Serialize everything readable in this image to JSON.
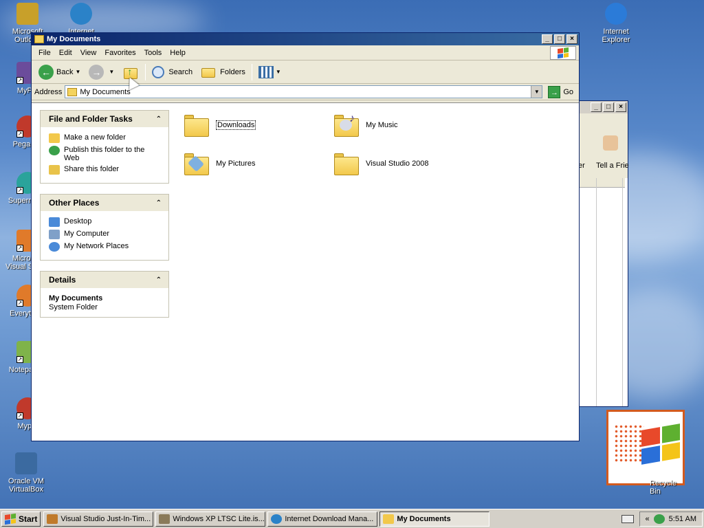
{
  "desktop": {
    "icons": [
      {
        "label": "Microsoft Outlook",
        "color": "#c8a02a"
      },
      {
        "label": "Internet Download Manager",
        "color": "#2b82c8"
      },
      {
        "label": "MyPal",
        "color": "#6b4c9b"
      },
      {
        "label": "Pegasus",
        "color": "#c0392b"
      },
      {
        "label": "Supermium",
        "color": "#2aa39b"
      },
      {
        "label": "Microsoft Visual Studio",
        "color": "#e07a2a"
      },
      {
        "label": "Everything",
        "color": "#e07a2a"
      },
      {
        "label": "Notepad++",
        "color": "#7fb34a"
      },
      {
        "label": "Mypal",
        "color": "#c0392b"
      },
      {
        "label": "Oracle VM VirtualBox",
        "color": "#3b6aa0"
      },
      {
        "label": "Internet Explorer",
        "color": "#2b7bd8"
      }
    ],
    "recycle_bin": "Recycle Bin"
  },
  "explorer": {
    "title": "My Documents",
    "title_buttons": [
      "_",
      "□",
      "×"
    ],
    "menu": [
      "File",
      "Edit",
      "View",
      "Favorites",
      "Tools",
      "Help"
    ],
    "toolbar": {
      "back": "Back",
      "search": "Search",
      "folders": "Folders"
    },
    "address": {
      "label": "Address",
      "value": "My Documents",
      "go": "Go"
    },
    "panels": {
      "file_tasks": {
        "title": "File and Folder Tasks",
        "items": [
          "Make a new folder",
          "Publish this folder to the Web",
          "Share this folder"
        ]
      },
      "other_places": {
        "title": "Other Places",
        "items": [
          "Desktop",
          "My Computer",
          "My Network Places"
        ]
      },
      "details": {
        "title": "Details",
        "name": "My Documents",
        "type": "System Folder"
      }
    },
    "files": [
      "Downloads",
      "My Music",
      "My Pictures",
      "Visual Studio 2008"
    ]
  },
  "back_window": {
    "toolbar_label_partial_1": "er",
    "toolbar_label_partial_2": "Tell a Frie"
  },
  "taskbar": {
    "start": "Start",
    "tasks": [
      "Visual Studio Just-In-Tim...",
      "Windows XP LTSC Lite.is...",
      "Internet Download Mana...",
      "My Documents"
    ],
    "tray_chevron": "«",
    "clock": "5:51 AM"
  },
  "colors": {
    "title_bar": "#0a246a",
    "desktop_blue": "#3b6db5",
    "folder": "#f2c84b",
    "recycle_border": "#d35a1e"
  }
}
